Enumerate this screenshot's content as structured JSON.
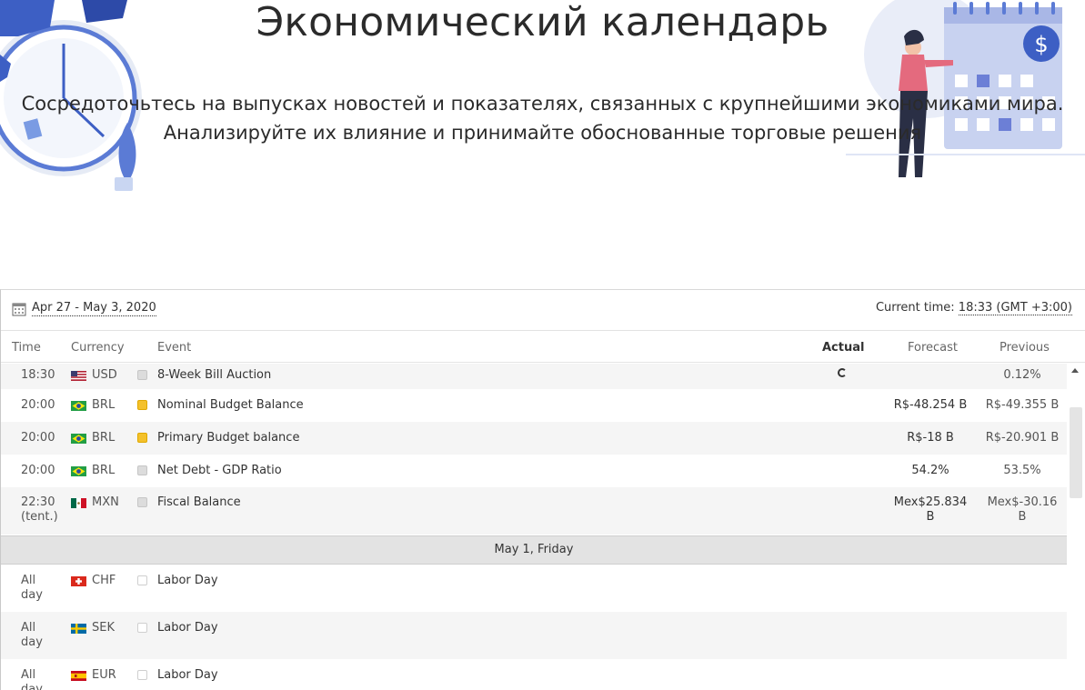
{
  "hero": {
    "title": "Экономический календарь",
    "subtitle_line1": "Сосредоточьтесь на выпусках новостей и показателях, связанных с крупнейшими экономиками мира.",
    "subtitle_line2": "Анализируйте их влияние и принимайте обоснованные торговые решения"
  },
  "toolbar": {
    "date_range": "Apr 27 - May 3, 2020",
    "current_time_label": "Current time:",
    "current_time_value": "18:33 (GMT +3:00)"
  },
  "columns": {
    "time": "Time",
    "currency": "Currency",
    "event": "Event",
    "actual": "Actual",
    "forecast": "Forecast",
    "previous": "Previous"
  },
  "rows": [
    {
      "time": "18:30",
      "time2": "",
      "currency": "USD",
      "flag": "us-flag-icon",
      "importance": "low",
      "event": "8-Week Bill Auction",
      "actual": "loading",
      "forecast": "",
      "forecast2": "",
      "previous": "0.12%",
      "previous2": ""
    },
    {
      "time": "20:00",
      "time2": "",
      "currency": "BRL",
      "flag": "br-flag-icon",
      "importance": "medium",
      "event": "Nominal Budget Balance",
      "actual": "",
      "forecast": "R$-48.254 B",
      "forecast2": "",
      "previous": "R$-49.355 B",
      "previous2": ""
    },
    {
      "time": "20:00",
      "time2": "",
      "currency": "BRL",
      "flag": "br-flag-icon",
      "importance": "medium",
      "event": "Primary Budget balance",
      "actual": "",
      "forecast": "R$-18 B",
      "forecast2": "",
      "previous": "R$-20.901 B",
      "previous2": ""
    },
    {
      "time": "20:00",
      "time2": "",
      "currency": "BRL",
      "flag": "br-flag-icon",
      "importance": "low",
      "event": "Net Debt - GDP Ratio",
      "actual": "",
      "forecast": "54.2%",
      "forecast2": "",
      "previous": "53.5%",
      "previous2": ""
    },
    {
      "time": "22:30",
      "time2": "(tent.)",
      "currency": "MXN",
      "flag": "mx-flag-icon",
      "importance": "low",
      "event": "Fiscal Balance",
      "actual": "",
      "forecast": "Mex$25.834",
      "forecast2": "B",
      "previous": "Mex$-30.16",
      "previous2": "B"
    }
  ],
  "day_header": "May 1, Friday",
  "rows2": [
    {
      "time": "All",
      "time2": "day",
      "currency": "CHF",
      "flag": "ch-flag-icon",
      "importance": "none",
      "event": "Labor Day"
    },
    {
      "time": "All",
      "time2": "day",
      "currency": "SEK",
      "flag": "se-flag-icon",
      "importance": "none",
      "event": "Labor Day"
    },
    {
      "time": "All",
      "time2": "day",
      "currency": "EUR",
      "flag": "es-flag-icon",
      "importance": "none",
      "event": "Labor Day"
    }
  ],
  "colors": {
    "medium_importance": "#f4c12b",
    "low_importance": "#dcdcdc",
    "day_header_bg": "#e3e3e3",
    "alt_row_bg": "#f5f5f5"
  }
}
